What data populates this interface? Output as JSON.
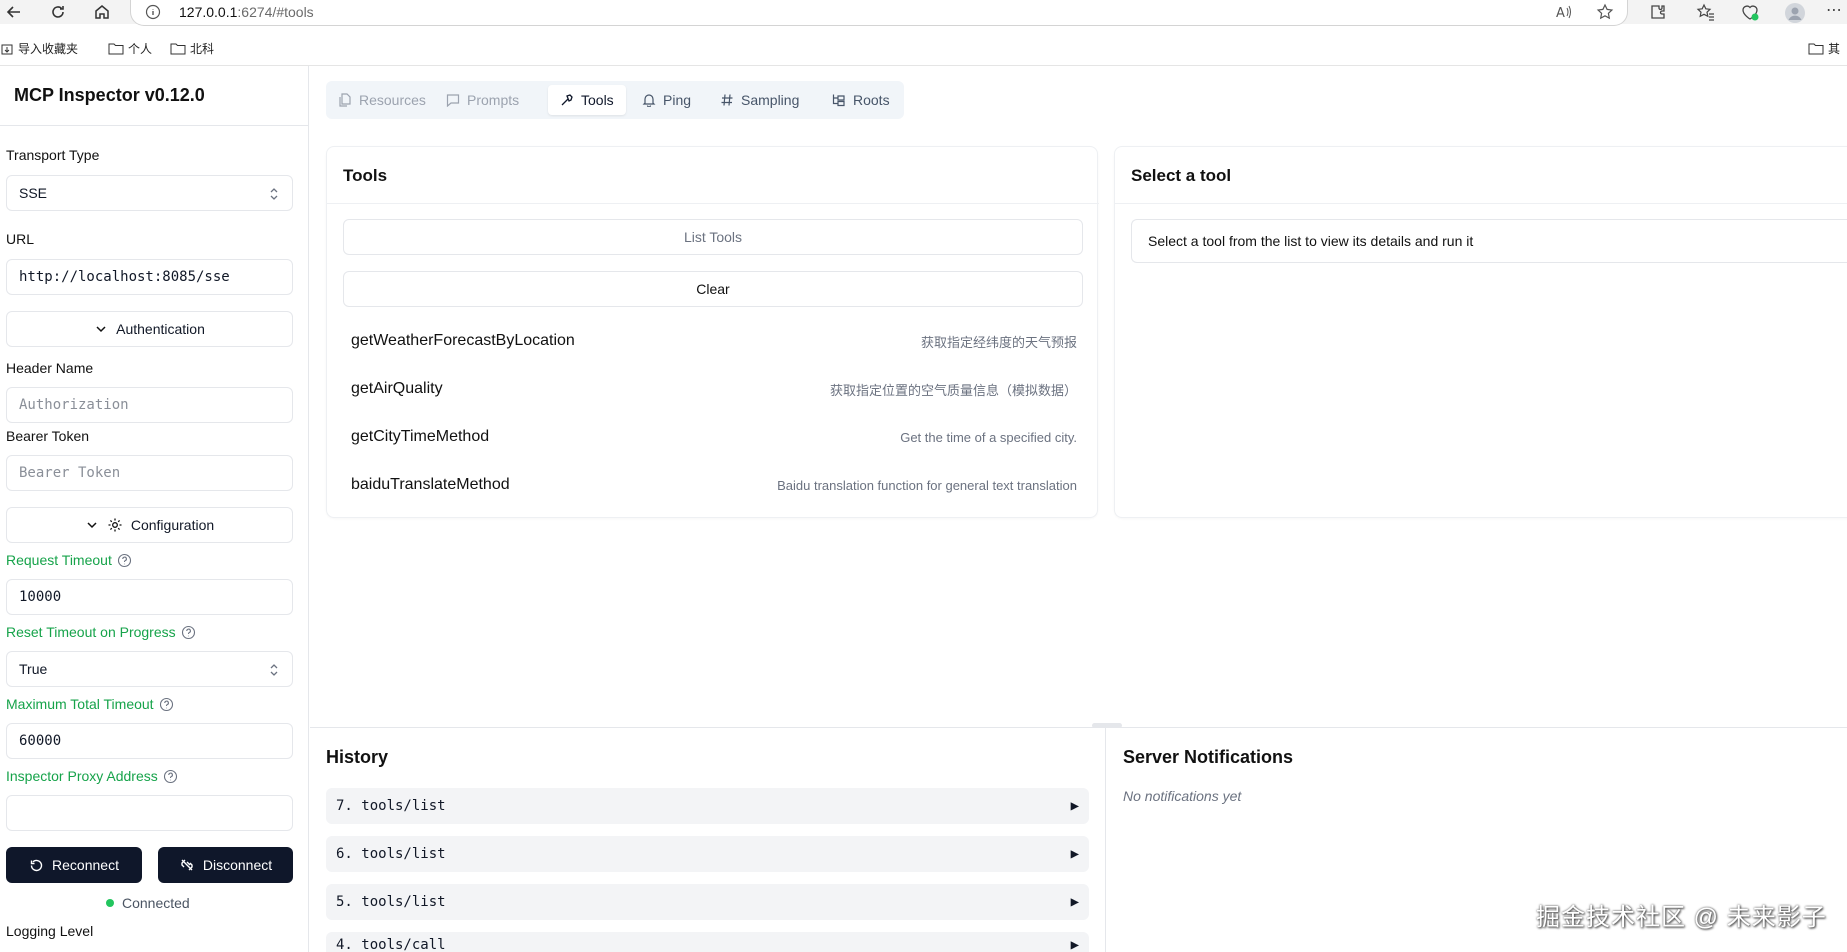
{
  "browser": {
    "url_host": "127.0.0.1",
    "url_rest": ":6274/#tools",
    "bookmarks": [
      {
        "label": "导入收藏夹"
      },
      {
        "label": "个人"
      },
      {
        "label": "北科"
      },
      {
        "label": "其"
      }
    ]
  },
  "sidebar": {
    "title": "MCP Inspector v0.12.0",
    "transport_label": "Transport Type",
    "transport_value": "SSE",
    "url_label": "URL",
    "url_value": "http://localhost:8085/sse",
    "auth_toggle": "Authentication",
    "header_name_label": "Header Name",
    "header_name_placeholder": "Authorization",
    "bearer_label": "Bearer Token",
    "bearer_placeholder": "Bearer Token",
    "config_toggle": "Configuration",
    "request_timeout_label": "Request Timeout",
    "request_timeout_value": "10000",
    "reset_timeout_label": "Reset Timeout on Progress",
    "reset_timeout_value": "True",
    "max_timeout_label": "Maximum Total Timeout",
    "max_timeout_value": "60000",
    "proxy_label": "Inspector Proxy Address",
    "proxy_value": "",
    "reconnect_label": "Reconnect",
    "disconnect_label": "Disconnect",
    "status": "Connected",
    "logging_label": "Logging Level"
  },
  "tabs": [
    {
      "label": "Resources"
    },
    {
      "label": "Prompts"
    },
    {
      "label": "Tools"
    },
    {
      "label": "Ping"
    },
    {
      "label": "Sampling"
    },
    {
      "label": "Roots"
    }
  ],
  "tools_panel": {
    "title": "Tools",
    "list_button": "List Tools",
    "clear_button": "Clear",
    "items": [
      {
        "name": "getWeatherForecastByLocation",
        "desc": "获取指定经纬度的天气预报"
      },
      {
        "name": "getAirQuality",
        "desc": "获取指定位置的空气质量信息（模拟数据）"
      },
      {
        "name": "getCityTimeMethod",
        "desc": "Get the time of a specified city."
      },
      {
        "name": "baiduTranslateMethod",
        "desc": "Baidu translation function for general text translation"
      }
    ]
  },
  "detail_panel": {
    "title": "Select a tool",
    "message": "Select a tool from the list to view its details and run it"
  },
  "history": {
    "title": "History",
    "items": [
      {
        "label": "7. tools/list"
      },
      {
        "label": "6. tools/list"
      },
      {
        "label": "5. tools/list"
      },
      {
        "label": "4. tools/call"
      }
    ]
  },
  "notifications": {
    "title": "Server Notifications",
    "empty": "No notifications yet"
  },
  "watermark": "掘金技术社区 @ 未来影子",
  "colors": {
    "accent_green": "#16a34a",
    "dark_button": "#0f172a",
    "status_dot": "#22c55e"
  }
}
